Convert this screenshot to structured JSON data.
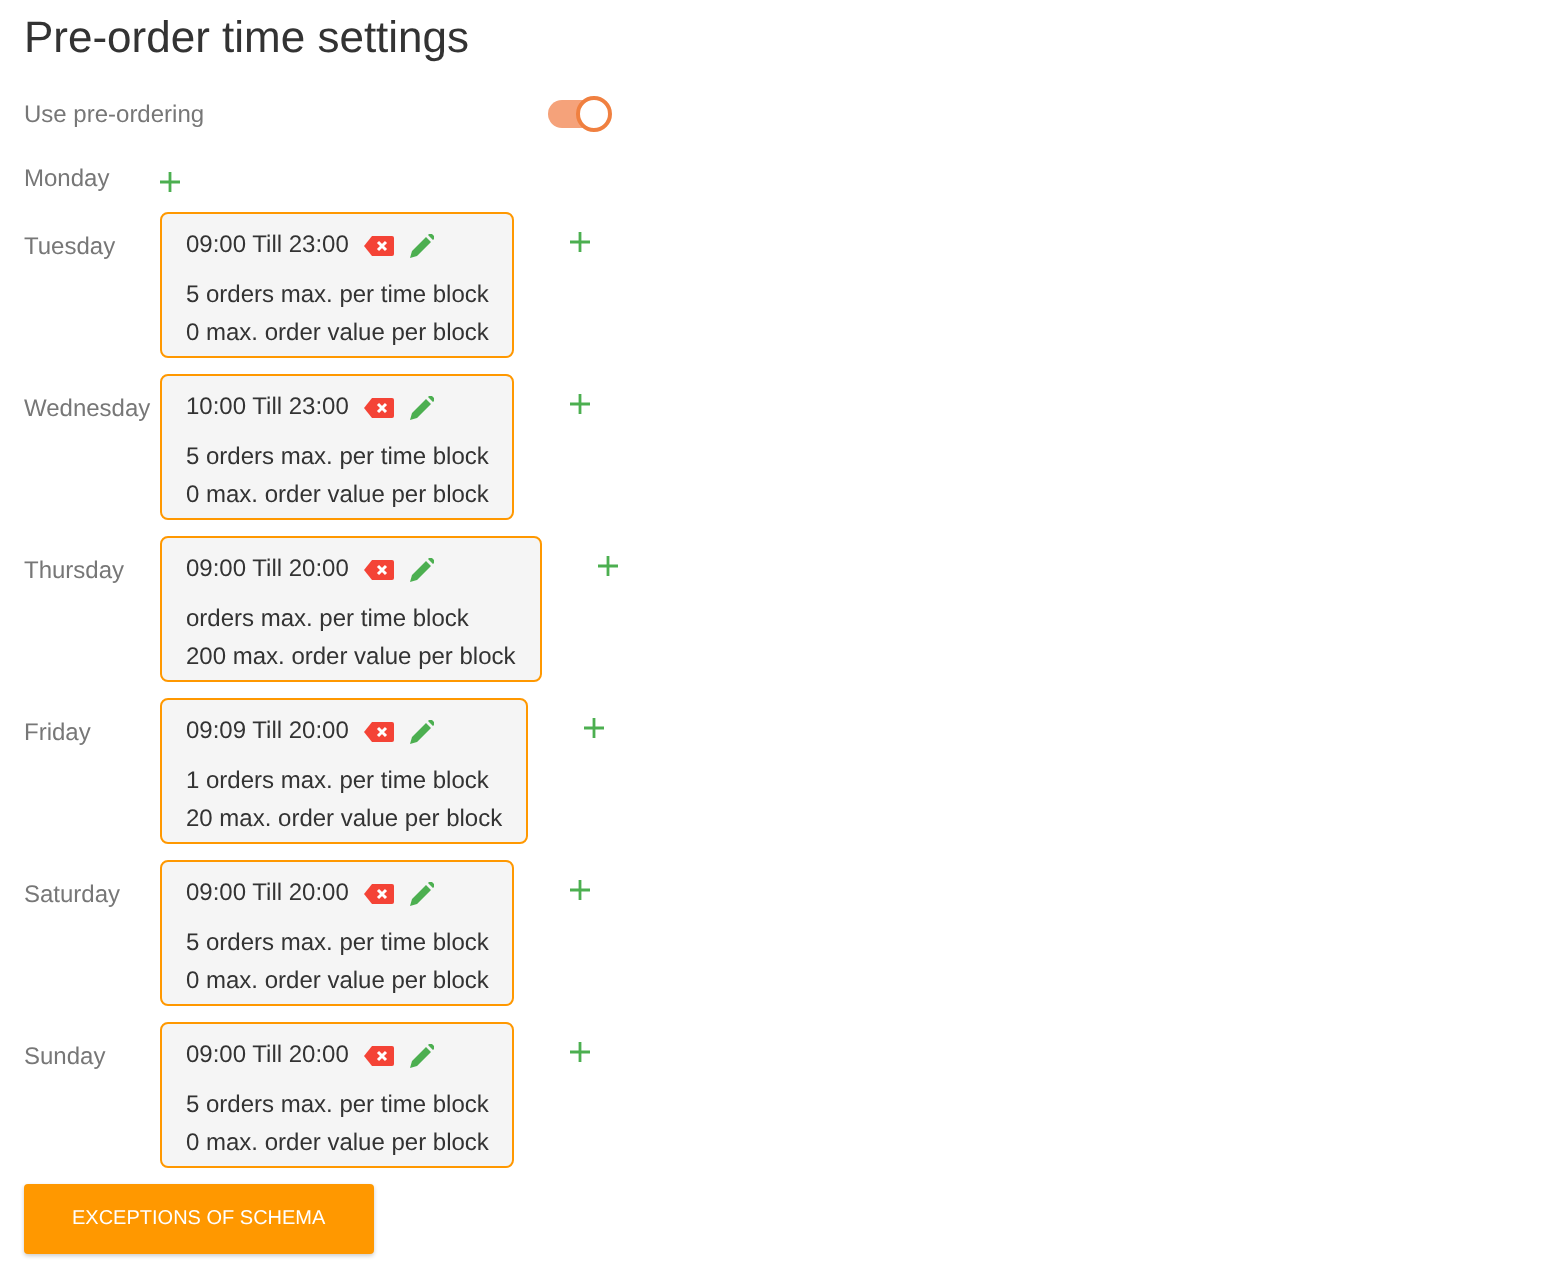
{
  "title": "Pre-order time settings",
  "preordering": {
    "label": "Use pre-ordering",
    "on": true
  },
  "days": [
    {
      "name": "Monday"
    },
    {
      "name": "Tuesday",
      "slots": [
        {
          "time": "09:00 Till 23:00",
          "orders": "5 orders max. per time block",
          "value": "0 max. order value per block"
        }
      ]
    },
    {
      "name": "Wednesday",
      "slots": [
        {
          "time": "10:00 Till 23:00",
          "orders": "5 orders max. per time block",
          "value": "0 max. order value per block"
        }
      ]
    },
    {
      "name": "Thursday",
      "slots": [
        {
          "time": "09:00 Till 20:00",
          "orders": "orders max. per time block",
          "value": "200 max. order value per block"
        }
      ]
    },
    {
      "name": "Friday",
      "slots": [
        {
          "time": "09:09 Till 20:00",
          "orders": "1 orders max. per time block",
          "value": "20 max. order value per block"
        }
      ]
    },
    {
      "name": "Saturday",
      "slots": [
        {
          "time": "09:00 Till 20:00",
          "orders": "5 orders max. per time block",
          "value": "0 max. order value per block"
        }
      ]
    },
    {
      "name": "Sunday",
      "slots": [
        {
          "time": "09:00 Till 20:00",
          "orders": "5 orders max. per time block",
          "value": "0 max. order value per block"
        }
      ]
    }
  ],
  "exceptions_button": "EXCEPTIONS OF SCHEMA"
}
